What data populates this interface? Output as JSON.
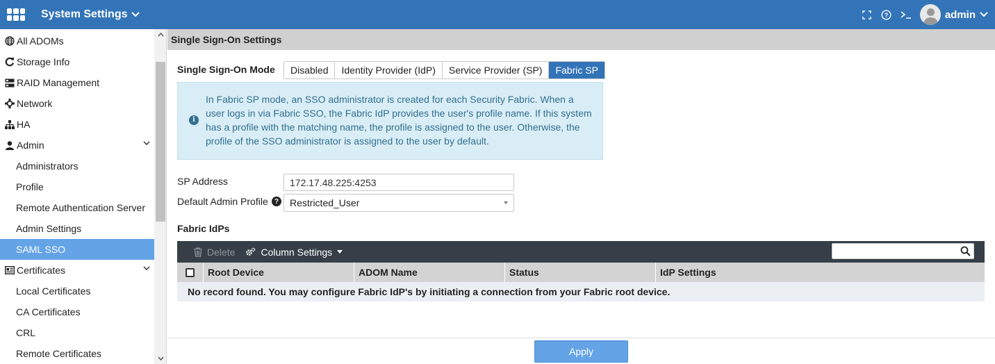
{
  "header": {
    "app_title": "System Settings",
    "user_name": "admin",
    "icons": [
      "fortinet-logo-icon",
      "chevron-down-icon",
      "fullscreen-icon",
      "help-icon",
      "cli-console-icon",
      "user-avatar-icon"
    ]
  },
  "sidebar": {
    "items": [
      {
        "label": "All ADOMs",
        "icon": "globe-icon"
      },
      {
        "label": "Storage Info",
        "icon": "storage-refresh-icon"
      },
      {
        "label": "RAID Management",
        "icon": "raid-icon"
      },
      {
        "label": "Network",
        "icon": "network-icon"
      },
      {
        "label": "HA",
        "icon": "sitemap-icon"
      },
      {
        "label": "Admin",
        "icon": "user-icon",
        "expanded": true
      },
      {
        "label": "Administrators"
      },
      {
        "label": "Profile"
      },
      {
        "label": "Remote Authentication Server"
      },
      {
        "label": "Admin Settings"
      },
      {
        "label": "SAML SSO",
        "active": true
      },
      {
        "label": "Certificates",
        "icon": "certificate-icon",
        "expanded": true
      },
      {
        "label": "Local Certificates"
      },
      {
        "label": "CA Certificates"
      },
      {
        "label": "CRL"
      },
      {
        "label": "Remote Certificates"
      }
    ]
  },
  "main": {
    "section_title": "Single Sign-On Settings",
    "sso_mode": {
      "label": "Single Sign-On Mode",
      "options": [
        "Disabled",
        "Identity Provider (IdP)",
        "Service Provider (SP)",
        "Fabric SP"
      ],
      "selected": "Fabric SP"
    },
    "info_text": "In Fabric SP mode, an SSO administrator is created for each Security Fabric. When a user logs in via Fabric SSO, the Fabric IdP provides the user's profile name. If this system has a profile with the matching name, the profile is assigned to the user. Otherwise, the profile of the SSO administrator is assigned to the user by default.",
    "sp_address": {
      "label": "SP Address",
      "value": "172.17.48.225:4253"
    },
    "default_admin_profile": {
      "label": "Default Admin Profile",
      "value": "Restricted_User"
    },
    "fabric_idps": {
      "title": "Fabric IdPs",
      "toolbar": {
        "delete_label": "Delete",
        "column_settings_label": "Column Settings",
        "search_placeholder": ""
      },
      "columns": [
        "Root Device",
        "ADOM Name",
        "Status",
        "IdP Settings"
      ],
      "empty_message": "No record found. You may configure Fabric IdP's by initiating a connection from your Fabric root device."
    },
    "apply_label": "Apply"
  },
  "colors": {
    "topbar": "#3374b8",
    "active_nav": "#64a4e6",
    "segment_active": "#3374b8",
    "info_bg": "#d9edf6",
    "info_text": "#31708f",
    "toolbar_bg": "#363f48",
    "apply_button": "#64a4e6"
  }
}
